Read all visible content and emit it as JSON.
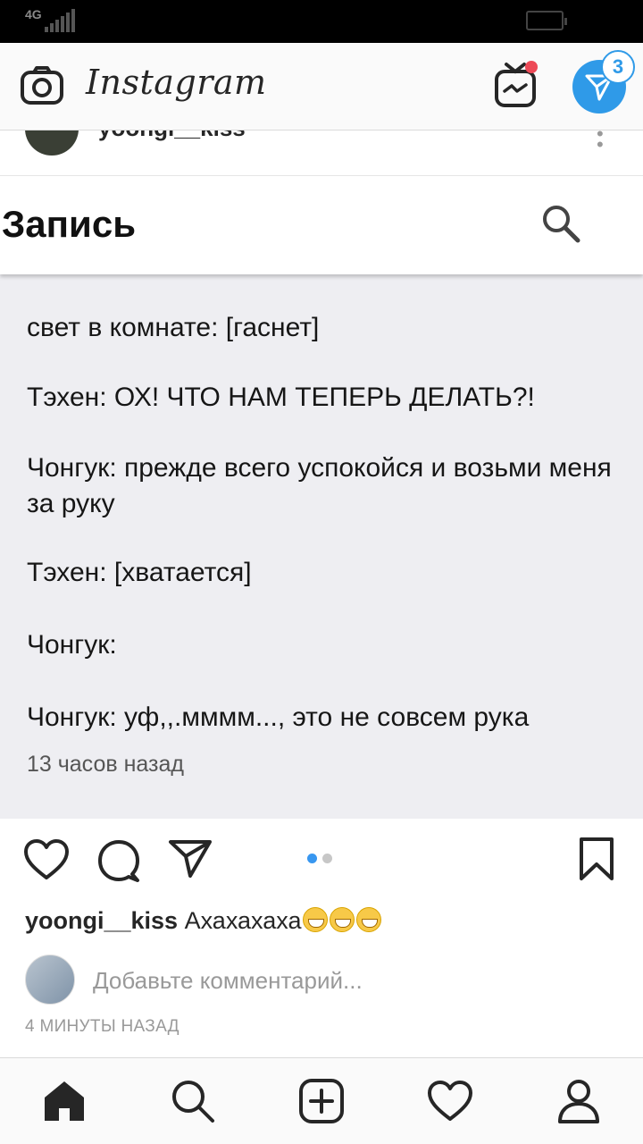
{
  "status_bar": {
    "network": "4G"
  },
  "header": {
    "logo": "Instagram",
    "direct_badge": "3"
  },
  "post": {
    "author": "yoongi__kiss",
    "image_content": {
      "title": "Запись",
      "lines": [
        "свет в комнате: [гаснет]",
        "Тэхен: ОХ! ЧТО НАМ ТЕПЕРЬ ДЕЛАТЬ?!",
        "Чонгук: прежде всего успокойся и возьми меня за руку",
        "Тэхен: [хватается]",
        "Чонгук:",
        "Чонгук: уф,,.мммм..., это не совсем рука"
      ],
      "time": "13 часов назад"
    },
    "carousel": {
      "active_color": "#3897f0",
      "inactive_color": "#c7c7c7"
    },
    "caption": {
      "username": "yoongi__kiss",
      "text": "Ахахахаха"
    },
    "comment_placeholder": "Добавьте комментарий...",
    "timestamp": "4 МИНУТЫ НАЗАД"
  },
  "icons": {
    "header": [
      "camera-icon",
      "igtv-icon",
      "direct-icon"
    ],
    "actions": [
      "heart-icon",
      "comment-icon",
      "share-icon",
      "bookmark-icon"
    ],
    "nav": [
      "home-icon",
      "search-icon",
      "add-icon",
      "heart-icon",
      "profile-icon"
    ]
  },
  "colors": {
    "accent": "#2f9ae8",
    "notification": "#ed4956"
  }
}
